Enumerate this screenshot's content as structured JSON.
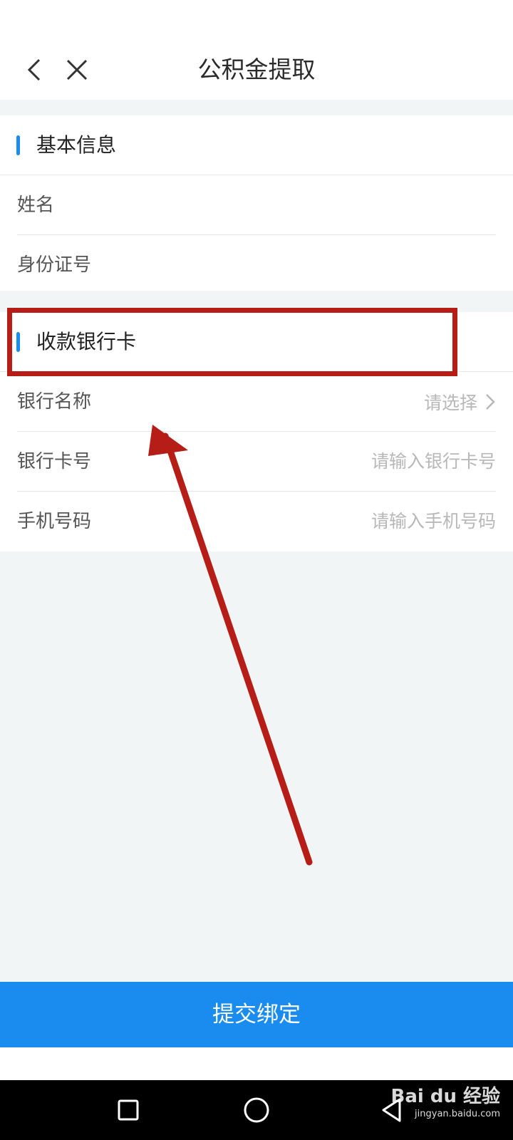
{
  "header": {
    "title": "公积金提取"
  },
  "basic_info": {
    "title": "基本信息",
    "name_label": "姓名",
    "id_label": "身份证号"
  },
  "bank_card": {
    "title": "收款银行卡",
    "bank_name_label": "银行名称",
    "bank_name_placeholder": "请选择",
    "card_no_label": "银行卡号",
    "card_no_placeholder": "请输入银行卡号",
    "phone_label": "手机号码",
    "phone_placeholder": "请输入手机号码"
  },
  "submit_label": "提交绑定",
  "watermark": {
    "main": "Bai du 经验",
    "sub": "jingyan.baidu.com"
  },
  "colors": {
    "accent": "#1a8cf0",
    "annotation": "#b51d16"
  }
}
